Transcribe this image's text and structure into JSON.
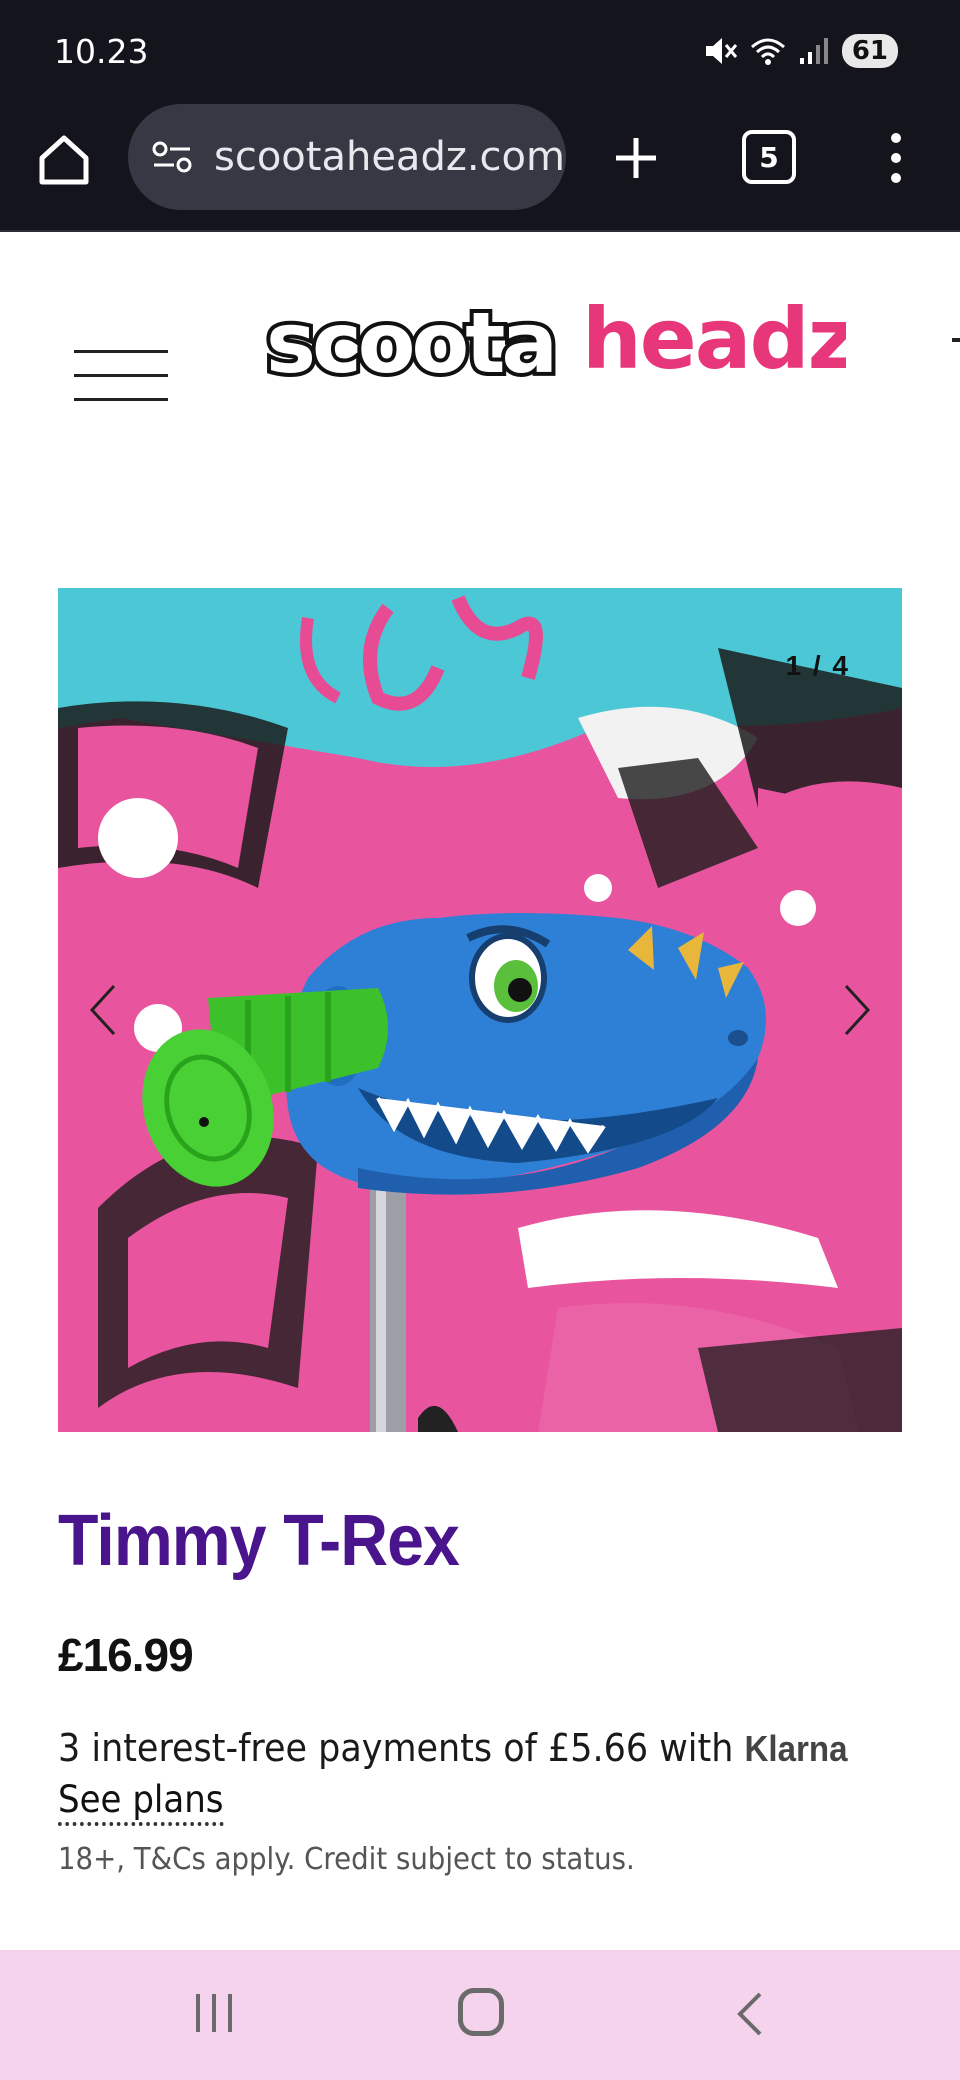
{
  "status_bar": {
    "time": "10.23",
    "battery": "61",
    "icons": [
      "mute-icon",
      "wifi-icon",
      "signal-icon",
      "battery-icon"
    ]
  },
  "browser": {
    "url": "scootaheadz.com",
    "tab_count": "5",
    "icons": [
      "home-icon",
      "site-settings-icon",
      "new-tab-icon",
      "tab-switcher-icon",
      "more-menu-icon"
    ]
  },
  "site": {
    "logo_part1": "scoota",
    "logo_part2": "headz",
    "brand_colors": {
      "logo_pink": "#e8367a",
      "title_purple": "#4a148c"
    }
  },
  "gallery": {
    "counter": "1 / 4",
    "current": 1,
    "total": 4,
    "icons": [
      "chevron-left-icon",
      "chevron-right-icon"
    ]
  },
  "product": {
    "name": "Timmy T-Rex",
    "price": "£16.99",
    "installments_text": "3 interest-free payments of £5.66 with",
    "klarna_brand": "Klarna",
    "see_plans": "See plans",
    "disclaimer": "18+, T&Cs apply. Credit subject to status."
  },
  "nav_bar": {
    "background": "#f6d3ec",
    "icons": [
      "recents-icon",
      "home-circle-icon",
      "back-icon"
    ]
  }
}
